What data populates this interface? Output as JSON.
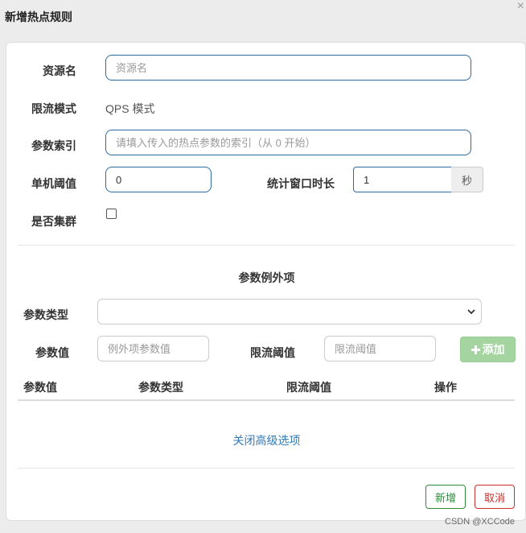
{
  "dialog": {
    "title": "新增热点规则",
    "close_icon": "close-icon"
  },
  "form": {
    "resource_name": {
      "label": "资源名",
      "placeholder": "资源名",
      "value": ""
    },
    "flow_mode": {
      "label": "限流模式",
      "value": "QPS 模式"
    },
    "param_index": {
      "label": "参数索引",
      "placeholder": "请填入传入的热点参数的索引（从 0 开始）",
      "value": ""
    },
    "threshold": {
      "label": "单机阈值",
      "value": "0"
    },
    "window": {
      "label": "统计窗口时长",
      "value": "1",
      "unit": "秒"
    },
    "cluster": {
      "label": "是否集群",
      "checked": false
    }
  },
  "exceptions": {
    "title": "参数例外项",
    "param_type": {
      "label": "参数类型",
      "selected": ""
    },
    "param_value": {
      "label": "参数值",
      "placeholder": "例外项参数值"
    },
    "limit": {
      "label": "限流阈值",
      "placeholder": "限流阈值"
    },
    "add_button": {
      "icon": "plus-icon",
      "label": "添加",
      "color": "#a4d4a0"
    },
    "table_headers": [
      "参数值",
      "参数类型",
      "限流阈值",
      "操作"
    ],
    "rows": []
  },
  "advanced_toggle": "关闭高级选项",
  "footer": {
    "save_label": "新增",
    "cancel_label": "取消",
    "save_color": "#2e8b3c",
    "cancel_color": "#c9302c"
  },
  "watermark": "CSDN @XCCode"
}
